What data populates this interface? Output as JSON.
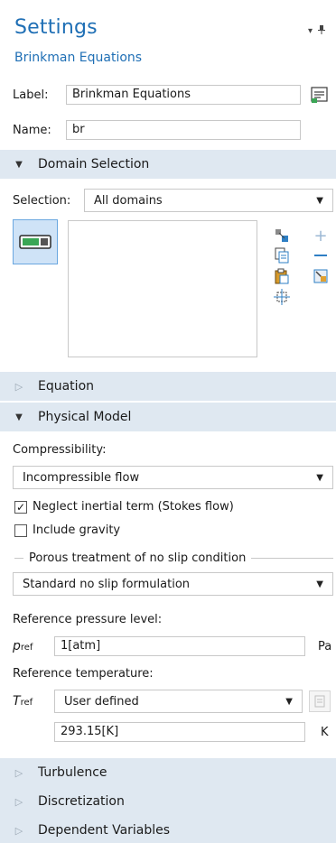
{
  "header": {
    "title": "Settings",
    "subtitle": "Brinkman Equations",
    "pin_glyph": "▾ ⏚"
  },
  "label_field": {
    "label": "Label:",
    "value": "Brinkman Equations"
  },
  "name_field": {
    "label": "Name:",
    "value": "br"
  },
  "sections": {
    "domain_selection": "Domain Selection",
    "equation": "Equation",
    "physical_model": "Physical Model",
    "turbulence": "Turbulence",
    "discretization": "Discretization",
    "dependent_variables": "Dependent Variables"
  },
  "domain": {
    "selection_label": "Selection:",
    "selection_value": "All domains"
  },
  "physical_model": {
    "compressibility_label": "Compressibility:",
    "compressibility_value": "Incompressible flow",
    "neglect_inertial": {
      "label": "Neglect inertial term (Stokes flow)",
      "checked": true
    },
    "include_gravity": {
      "label": "Include gravity",
      "checked": false
    },
    "porous_group_label": "Porous treatment of no slip condition",
    "porous_value": "Standard no slip formulation",
    "ref_pressure_label": "Reference pressure level:",
    "p_ref_symbol": "p",
    "p_ref_sub": "ref",
    "p_ref_value": "1[atm]",
    "p_ref_unit": "Pa",
    "ref_temperature_label": "Reference temperature:",
    "t_ref_symbol": "T",
    "t_ref_sub": "ref",
    "t_ref_mode": "User defined",
    "t_ref_value": "293.15[K]",
    "t_ref_unit": "K"
  },
  "icons": {
    "select_dropdown": "chevron-down-icon",
    "edit_label": "edit-label-icon",
    "domain_toggle": "domain-selection-toggle-icon",
    "copy": "copy-selection-icon",
    "paste": "paste-selection-icon",
    "zoom": "zoom-to-selection-icon",
    "add": "plus-icon",
    "remove": "minus-icon",
    "clear": "clear-selection-icon"
  },
  "colors": {
    "title_blue": "#1f6fb5",
    "section_bg": "#dfe8f1",
    "toggle_bg": "#cfe3f7"
  }
}
